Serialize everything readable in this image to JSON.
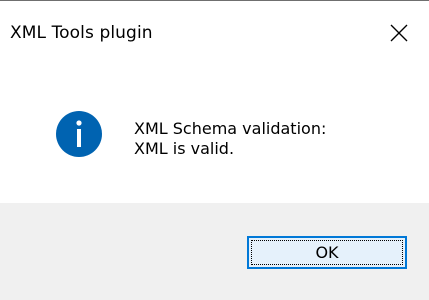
{
  "window": {
    "title": "XML Tools plugin"
  },
  "message": {
    "line1": "XML Schema validation:",
    "line2": "XML is valid.",
    "icon": "info-icon"
  },
  "buttons": {
    "ok_label": "OK"
  },
  "colors": {
    "info_icon": "#0063b1",
    "button_border": "#0078d7",
    "button_fill": "#e5f1fb",
    "footer": "#f0f0f0"
  }
}
